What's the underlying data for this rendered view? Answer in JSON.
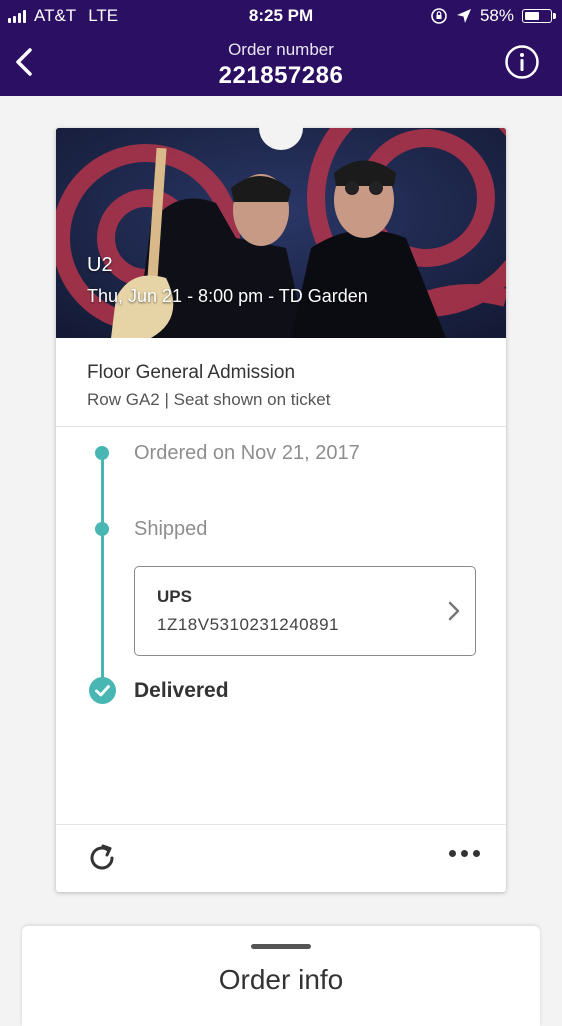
{
  "status_bar": {
    "carrier": "AT&T",
    "network": "LTE",
    "time": "8:25 PM",
    "battery_percent": "58%",
    "battery_level": 0.58
  },
  "header": {
    "back_icon": "chevron-left-icon",
    "title_label": "Order number",
    "order_number": "221857286",
    "info_icon": "info-circle-icon",
    "background_color": "#2b0f63"
  },
  "event": {
    "artist": "U2",
    "datetime_venue": "Thu, Jun 21 - 8:00 pm - TD Garden"
  },
  "ticket": {
    "section": "Floor General Admission",
    "row_seat": "Row GA2 | Seat shown on ticket"
  },
  "timeline": {
    "accent_color": "#48b7b4",
    "steps": [
      {
        "label": "Ordered on Nov 21, 2017",
        "state": "done"
      },
      {
        "label": "Shipped",
        "state": "done"
      },
      {
        "label": "Delivered",
        "state": "current"
      }
    ]
  },
  "tracking": {
    "carrier": "UPS",
    "number": "1Z18V5310231240891",
    "chevron_icon": "chevron-right-icon"
  },
  "footer_actions": {
    "refresh_icon": "refresh-icon",
    "more_icon": "more-horizontal-icon"
  },
  "sheet": {
    "title": "Order info"
  }
}
